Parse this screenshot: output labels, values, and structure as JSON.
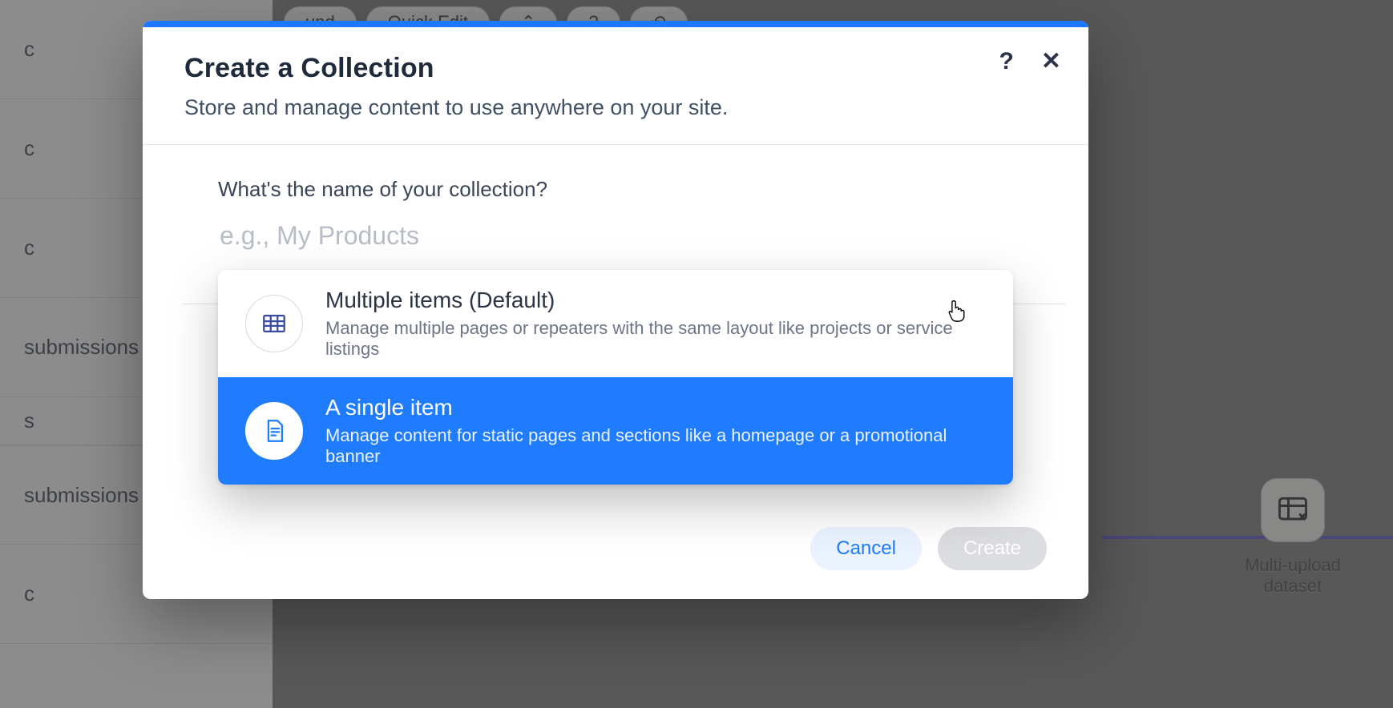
{
  "bg": {
    "sidebar_rows": [
      "c",
      "c",
      "c",
      "",
      "submissions",
      "s",
      "submissions",
      "",
      "c"
    ],
    "toolbuttons": [
      "und",
      "Quick Edit"
    ],
    "floating_label": "Multi-upload dataset"
  },
  "modal": {
    "title": "Create a Collection",
    "subtitle": "Store and manage content to use anywhere on your site.",
    "field_label": "What's the name of your collection?",
    "input_placeholder": "e.g., My Products",
    "input_value": "",
    "options": [
      {
        "title": "Multiple items (Default)",
        "desc": "Manage multiple pages or repeaters with the same layout like projects or service listings",
        "selected": false,
        "icon": "table-icon"
      },
      {
        "title": "A single item",
        "desc": "Manage content for static pages and sections like a homepage or a promotional banner",
        "selected": true,
        "icon": "document-icon"
      }
    ],
    "footer": {
      "cancel": "Cancel",
      "create": "Create"
    }
  }
}
